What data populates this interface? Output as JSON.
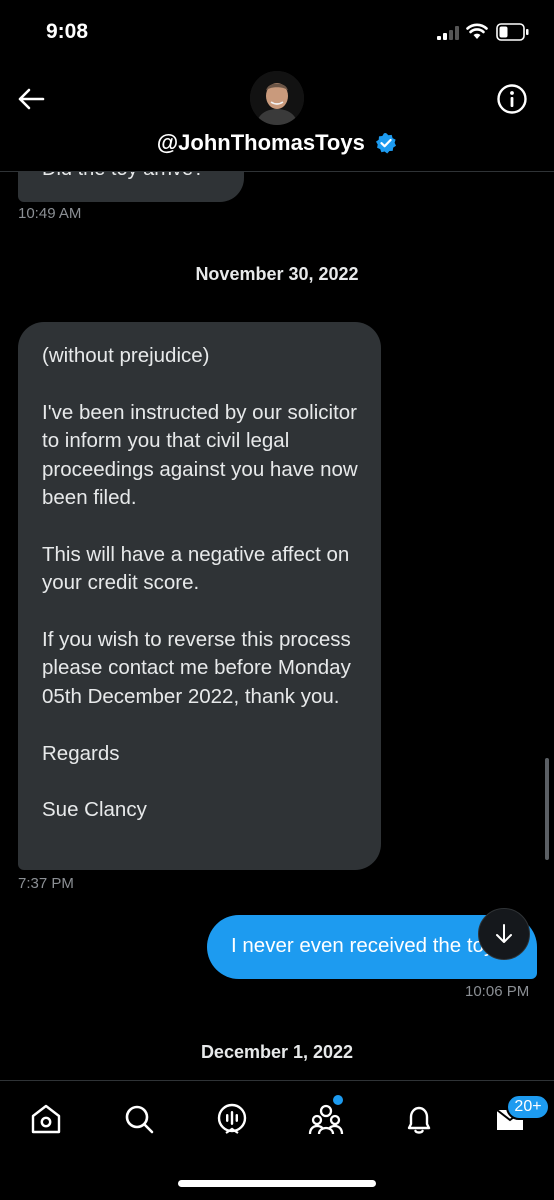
{
  "status_bar": {
    "time": "9:08"
  },
  "header": {
    "handle": "@JohnThomasToys"
  },
  "messages": {
    "partial_text": "Did the toy arrive?",
    "partial_time": "10:49 AM",
    "date1": "November 30, 2022",
    "long_paragraphs": [
      "(without prejudice)",
      "I've been instructed by our solicitor to inform you that civil legal proceedings against you have now been filed.",
      "This will have a negative affect on your credit score.",
      "If you wish to reverse this process please contact me before Monday 05th December 2022, thank you.",
      "Regards",
      "Sue Clancy"
    ],
    "long_time": "7:37 PM",
    "outgoing_text": "I never even received the toy",
    "outgoing_time": "10:06 PM",
    "date2": "December 1, 2022"
  },
  "bottom_nav": {
    "items": [
      "home-icon",
      "search-icon",
      "spaces-icon",
      "communities-icon",
      "notifications-icon",
      "messages-icon"
    ],
    "messages_badge": "20+"
  },
  "colors": {
    "accent": "#1d9bf0",
    "bubble_in": "#2f3336",
    "background": "#000000"
  }
}
